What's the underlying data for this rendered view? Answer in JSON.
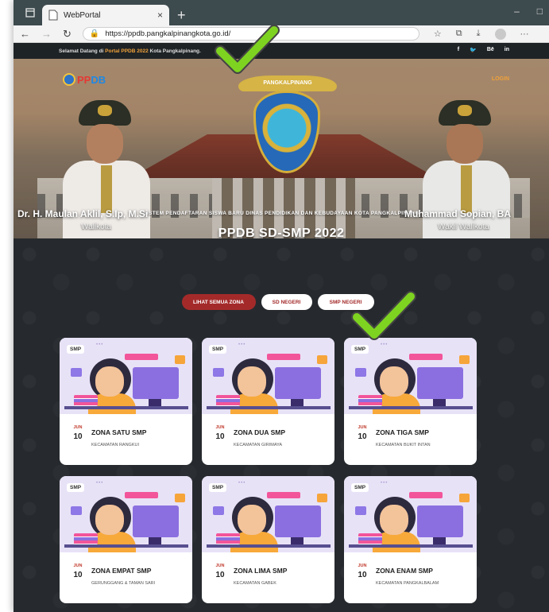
{
  "browser": {
    "tab_title": "WebPortal",
    "tab_close": "×",
    "new_tab": "+",
    "url": "https://ppdb.pangkalpinangkota.go.id/",
    "win_min": "–",
    "win_max": "□"
  },
  "topbar": {
    "welcome_prefix": "Selamat Datang di ",
    "welcome_highlight": "Portal PPDB 2022",
    "welcome_suffix": " Kota Pangkalpinang.",
    "social": [
      "f",
      "🐦",
      "Bē",
      "in"
    ]
  },
  "hero": {
    "logo_text_a": "PP",
    "logo_text_b": "DB",
    "login": "LOGIN",
    "emblem_ribbon": "PANGKALPINANG",
    "subtitle": "SISTEM PENDAFTARAN SISWA BARU DINAS PENDIDIKAN DAN KEBUDAYAAN KOTA PANGKALPINANG",
    "title": "PPDB SD-SMP 2022",
    "left_name": "Dr. H. Maulan Aklil, S.Ip, M.Si",
    "left_role": "Walikota",
    "right_name": "Muhammad Sopian, BA",
    "right_role": "Wakil Walikota"
  },
  "filters": {
    "all": "LIHAT SEMUA ZONA",
    "sd": "SD NEGERI",
    "smp": "SMP NEGERI"
  },
  "cards": [
    {
      "badge": "SMP",
      "month": "JUN",
      "day": "10",
      "title": "ZONA SATU SMP",
      "subtitle": "KECAMATAN RANGKUI"
    },
    {
      "badge": "SMP",
      "month": "JUN",
      "day": "10",
      "title": "ZONA DUA SMP",
      "subtitle": "KECAMATAN GIRIMAYA"
    },
    {
      "badge": "SMP",
      "month": "JUN",
      "day": "10",
      "title": "ZONA TIGA SMP",
      "subtitle": "KECAMATAN BUKIT INTAN"
    },
    {
      "badge": "SMP",
      "month": "JUN",
      "day": "10",
      "title": "ZONA EMPAT SMP",
      "subtitle": "GERUNGGANG & TAMAN SARI"
    },
    {
      "badge": "SMP",
      "month": "JUN",
      "day": "10",
      "title": "ZONA LIMA SMP",
      "subtitle": "KECAMATAN GABEK"
    },
    {
      "badge": "SMP",
      "month": "JUN",
      "day": "10",
      "title": "ZONA ENAM SMP",
      "subtitle": "KECAMATAN PANGKALBALAM"
    }
  ],
  "colors": {
    "accent_red": "#a42a2a",
    "accent_orange": "#f0a13b",
    "check_green": "#7ed321",
    "page_dark": "#262a2e"
  }
}
